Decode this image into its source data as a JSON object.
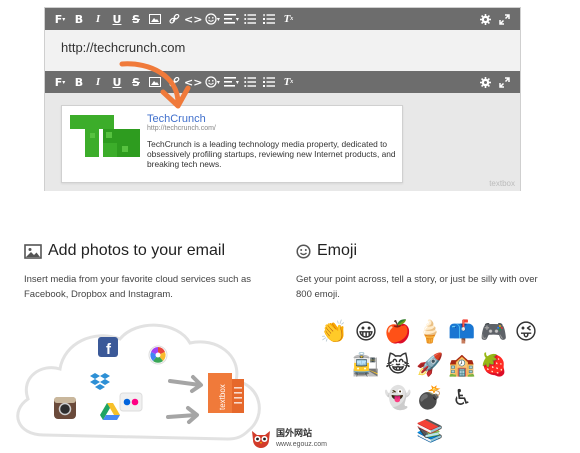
{
  "editor": {
    "toolbar_buttons": [
      "F",
      "B",
      "I",
      "U",
      "S",
      "image",
      "link",
      "code",
      "emoji",
      "align",
      "bullets",
      "numbered",
      "clear-format"
    ],
    "toolbar_labels": {
      "font": "F",
      "bold": "B",
      "italic": "I",
      "underline": "U",
      "strike": "S",
      "code": "<>"
    },
    "url_value": "http://techcrunch.com",
    "preview": {
      "title": "TechCrunch",
      "url": "http://techcrunch.com/",
      "description": "TechCrunch is a leading technology media property, dedicated to obsessively profiling startups, reviewing new Internet products, and breaking tech news."
    },
    "brand_mark": "textbox"
  },
  "features": {
    "photos": {
      "title": "Add photos to your email",
      "description": "Insert media from your favorite cloud services such as Facebook, Dropbox and Instagram.",
      "box_label": "textbox"
    },
    "emoji": {
      "title": "Emoji",
      "description": "Get your point across, tell a story, or just be silly with over 800 emoji.",
      "rows": [
        [
          "👏",
          "😀",
          "🍎",
          "🍦",
          "📫",
          "🎮",
          "😜"
        ],
        [
          "🚉",
          "😹",
          "🚀",
          "🏫",
          "🍓"
        ],
        [
          "👻",
          "💣",
          "♿"
        ],
        [
          "📚"
        ]
      ]
    }
  },
  "watermark": {
    "cn": "国外网站",
    "url": "www.egouz.com"
  },
  "colors": {
    "toolbar": "#6d6d6d",
    "arrow": "#f07a3a",
    "link": "#3f6fcc",
    "tc_green": "#3cad2a"
  }
}
